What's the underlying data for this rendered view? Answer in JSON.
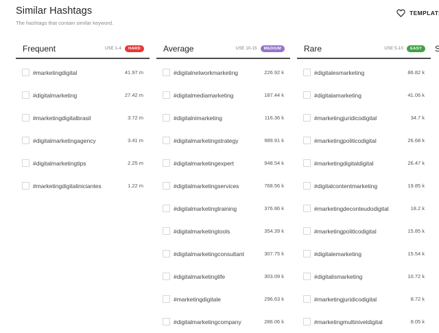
{
  "header": {
    "title": "Similar Hashtags",
    "subtitle": "The hashtags that contain similar keyword."
  },
  "templates_label": "TEMPLATES",
  "columns": [
    {
      "name": "Frequent",
      "use": "USE 1-4",
      "badge": "HARD",
      "badge_color": "#e53935",
      "rows": [
        {
          "tag": "#marketingdigital",
          "count": "41.97 m"
        },
        {
          "tag": "#digitalmarketing",
          "count": "27.42 m"
        },
        {
          "tag": "#marketingdigitalbrasil",
          "count": "3.72 m"
        },
        {
          "tag": "#digitalmarketingagency",
          "count": "3.41 m"
        },
        {
          "tag": "#digitalmarketingtips",
          "count": "2.25 m"
        },
        {
          "tag": "#marketingdigitaliniciantes",
          "count": "1.22 m"
        }
      ]
    },
    {
      "name": "Average",
      "use": "USE 10-15",
      "badge": "MEDIUM",
      "badge_color": "#9575cd",
      "rows": [
        {
          "tag": "#digitalnetworkmarketing",
          "count": "226.92 k"
        },
        {
          "tag": "#digitalmediamarketing",
          "count": "187.44 k"
        },
        {
          "tag": "#digitalnimarketing",
          "count": "116.36 k"
        },
        {
          "tag": "#digitalmarketingstrategy",
          "count": "989.91 k"
        },
        {
          "tag": "#digitalmarketingexpert",
          "count": "948.54 k"
        },
        {
          "tag": "#digitalmarketingservices",
          "count": "768.56 k"
        },
        {
          "tag": "#digitalmarketingtraining",
          "count": "376.86 k"
        },
        {
          "tag": "#digitalmarketingtools",
          "count": "354.39 k"
        },
        {
          "tag": "#digitalmarketingconsultant",
          "count": "307.75 k"
        },
        {
          "tag": "#digitalmarketinglife",
          "count": "303.09 k"
        },
        {
          "tag": "#marketingdigitale",
          "count": "296.63 k"
        },
        {
          "tag": "#digitalmarketingcompany",
          "count": "286.06 k"
        }
      ]
    },
    {
      "name": "Rare",
      "use": "USE 5-10",
      "badge": "EASY",
      "badge_color": "#43a047",
      "rows": [
        {
          "tag": "#digitalesmarketing",
          "count": "86.82 k"
        },
        {
          "tag": "#digitalamarketing",
          "count": "41.06 k"
        },
        {
          "tag": "#marketingjuridicodigital",
          "count": "34.7 k"
        },
        {
          "tag": "#marketingpoliticodigital",
          "count": "26.68 k"
        },
        {
          "tag": "#marketingdigitaldigital",
          "count": "26.47 k"
        },
        {
          "tag": "#digitalcontentmarketing",
          "count": "19.85 k"
        },
        {
          "tag": "#marketingdeconteudodigital",
          "count": "18.2 k"
        },
        {
          "tag": "#marketingpoliticodigital",
          "count": "15.85 k"
        },
        {
          "tag": "#digitalemarketing",
          "count": "15.54 k"
        },
        {
          "tag": "#digitalismarketing",
          "count": "10.72 k"
        },
        {
          "tag": "#marketingjuridicodigital",
          "count": "8.72 k"
        },
        {
          "tag": "#marketingmultiniveldigital",
          "count": "8.05 k"
        }
      ]
    }
  ],
  "next_column_peek": "S"
}
